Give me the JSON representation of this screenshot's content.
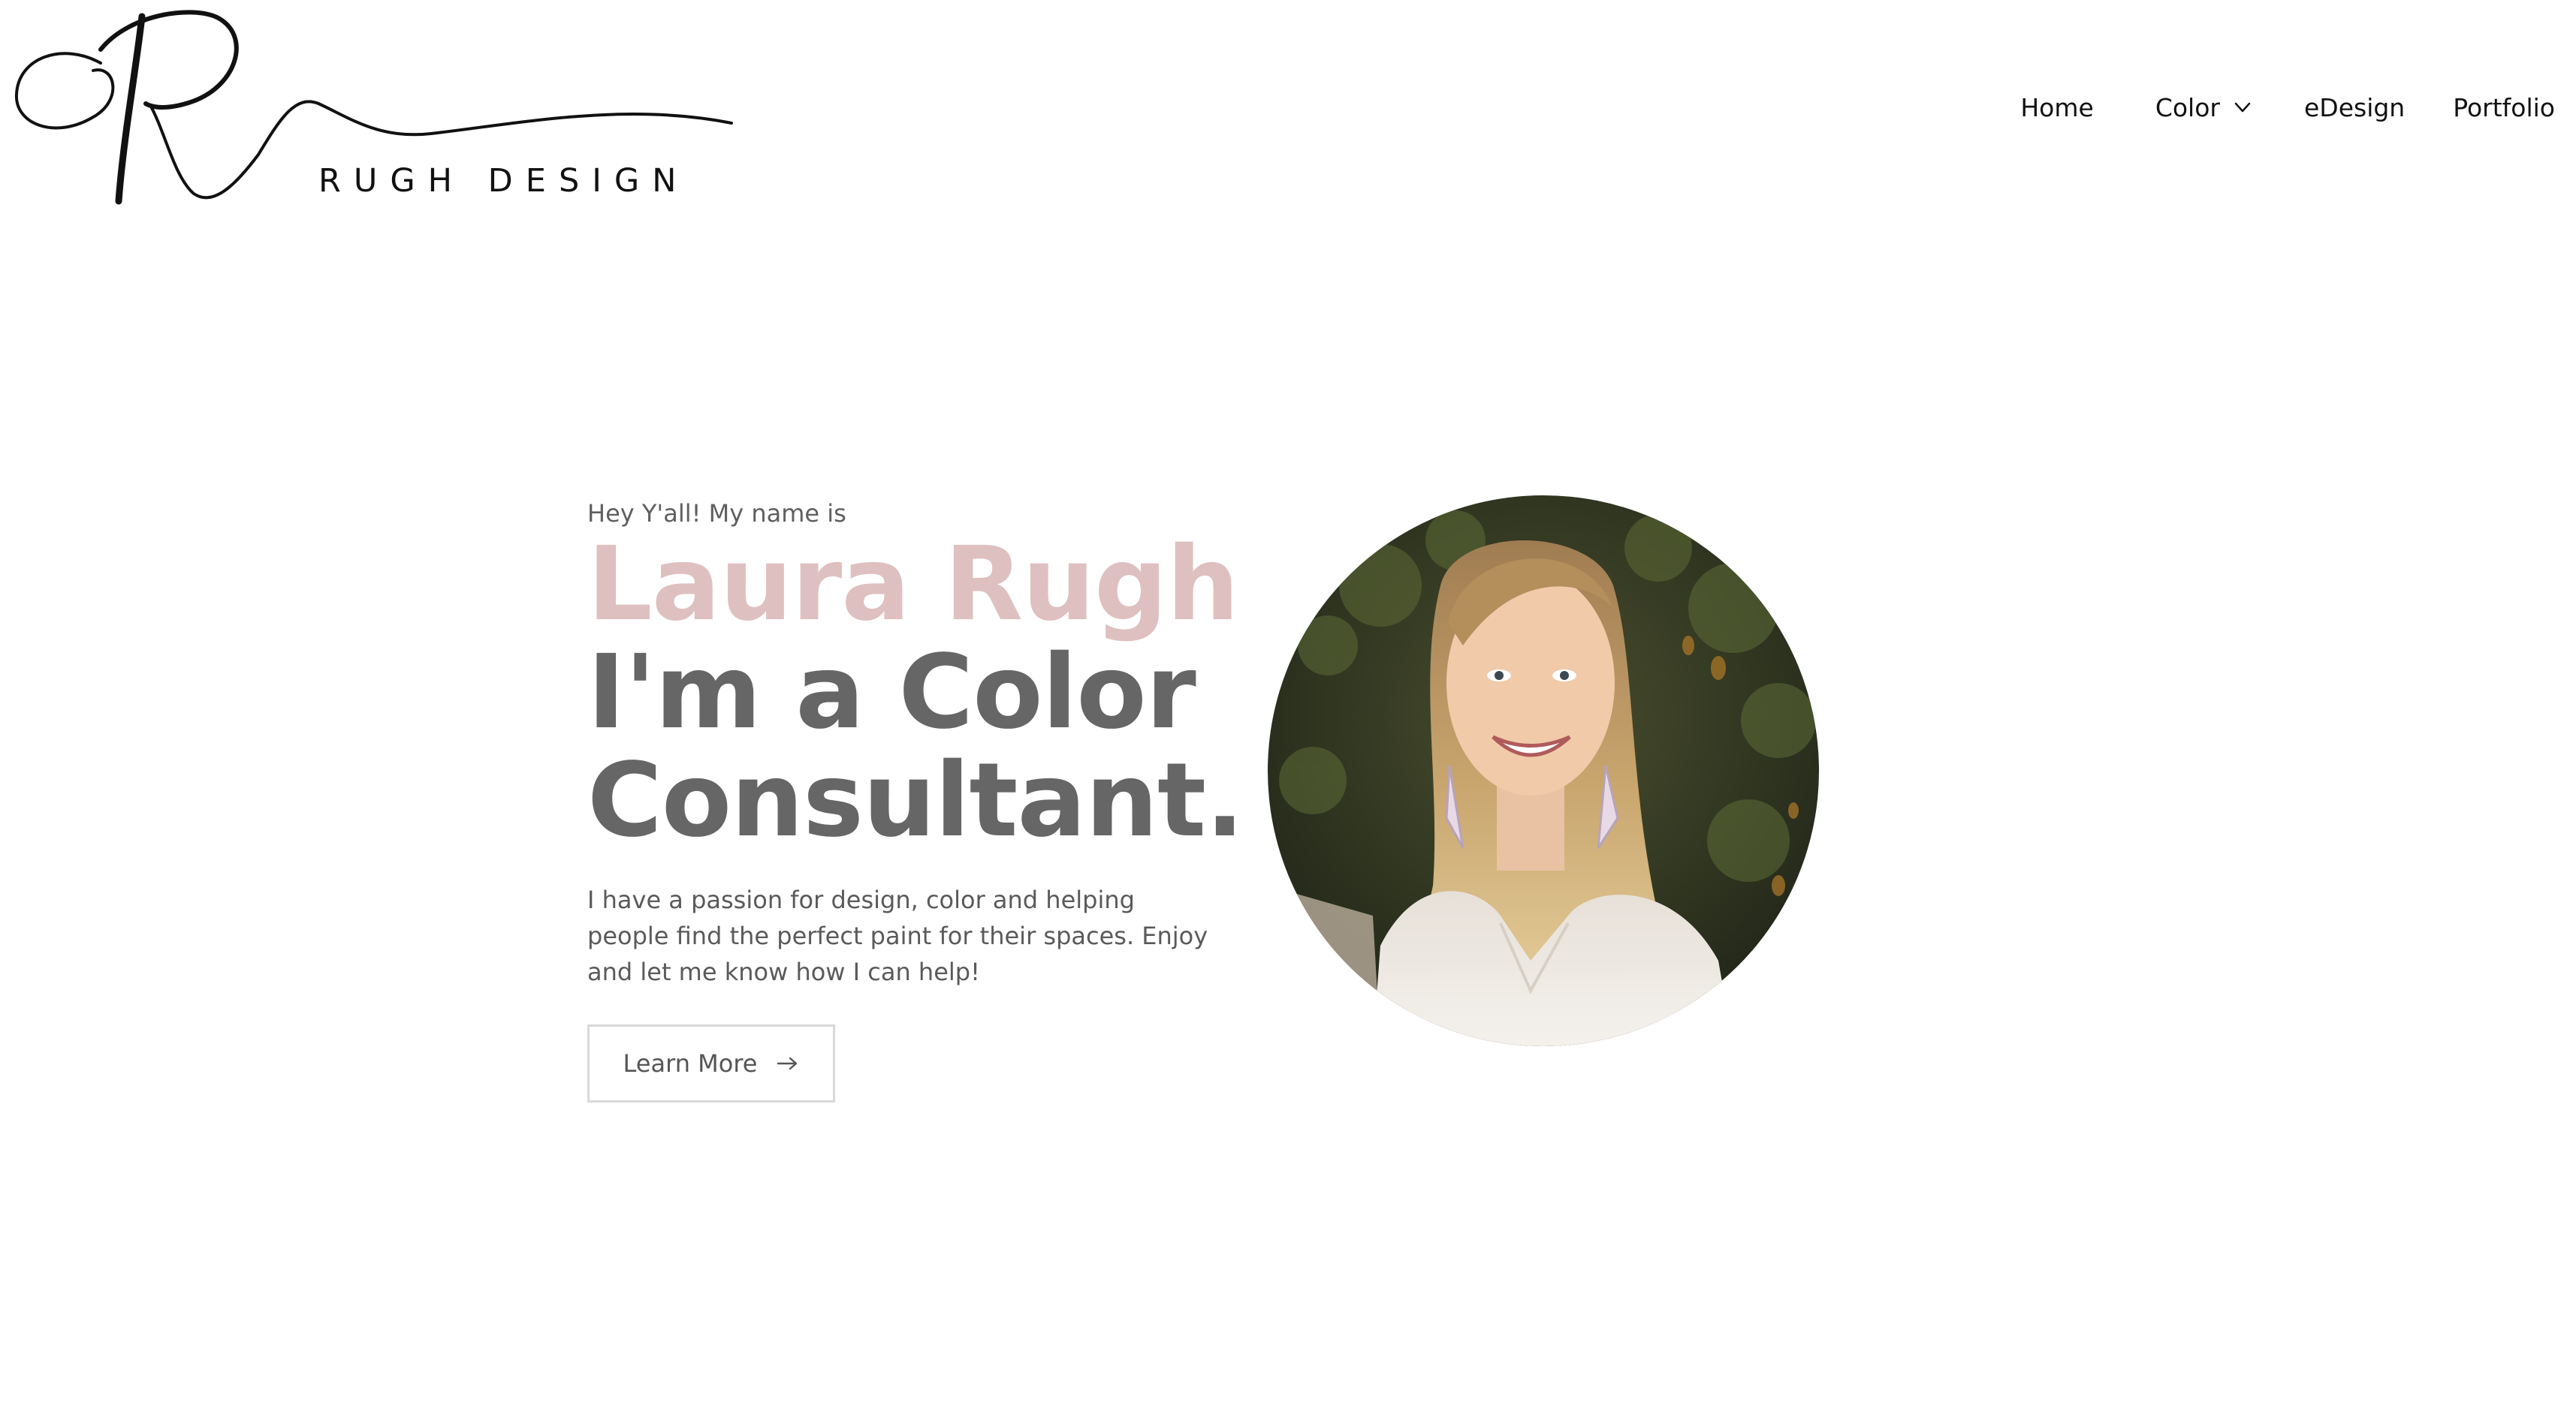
{
  "header": {
    "logo": {
      "monogram": "R",
      "wordmark": "RUGH DESIGN"
    },
    "nav": {
      "home": "Home",
      "color": "Color",
      "edesign": "eDesign",
      "portfolio": "Portfolio"
    }
  },
  "hero": {
    "kicker": "Hey Y'all! My name is",
    "name": "Laura Rugh",
    "headline_line1": "I'm a Color",
    "headline_line2": "Consultant.",
    "description": "I have a passion for design, color and helping people find the perfect paint for their spaces. Enjoy and let me know how I can help!",
    "button_label": "Learn More",
    "portrait_alt": "Laura Rugh"
  },
  "colors": {
    "accent_pink": "#dfc0c0",
    "headline_gray": "#666666",
    "body_gray": "#5a5a5a",
    "button_border": "#d9d9d9"
  },
  "icons": {
    "dropdown": "chevron-down-icon",
    "button_arrow": "arrow-right-icon"
  }
}
